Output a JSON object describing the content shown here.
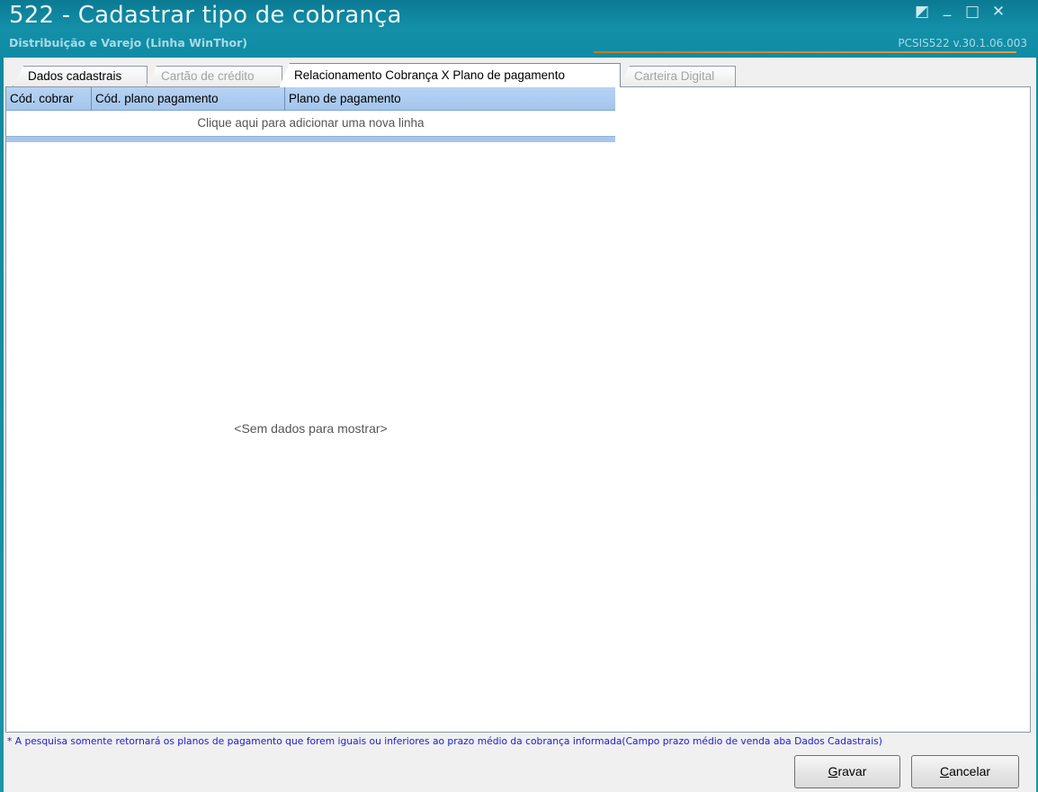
{
  "window": {
    "title": "522 - Cadastrar tipo de cobrança",
    "subtitle": "Distribuição e Varejo (Linha WinThor)",
    "version": "PCSIS522  v.30.1.06.003",
    "controls": {
      "restore": "◩",
      "minimize": "_",
      "maximize": "□",
      "close": "✕"
    }
  },
  "tabs": [
    {
      "label": "Dados cadastrais",
      "state": "enabled"
    },
    {
      "label": "Cartão de crédito",
      "state": "disabled"
    },
    {
      "label": "Relacionamento Cobrança X Plano de pagamento",
      "state": "active"
    },
    {
      "label": "Carteira Digital",
      "state": "disabled"
    }
  ],
  "grid": {
    "columns": [
      "Cód. cobrar",
      "Cód. plano pagamento",
      "Plano de pagamento"
    ],
    "new_row_text": "Clique aqui para adicionar uma nova linha",
    "rows": [],
    "empty_text": "<Sem dados para mostrar>"
  },
  "note": "* A pesquisa somente retornará os planos de pagamento que forem iguais ou inferiores ao prazo médio da cobrança informada(Campo prazo médio de venda aba Dados Cadastrais)",
  "buttons": {
    "save": {
      "mnemonic": "G",
      "rest": "ravar"
    },
    "cancel": {
      "mnemonic": "C",
      "rest": "ancelar"
    }
  },
  "colors": {
    "title_bar": "#1390a8",
    "accent_line": "#e49a3a",
    "grid_header": "#a4c5ec",
    "note_text": "#1b1bd8"
  }
}
